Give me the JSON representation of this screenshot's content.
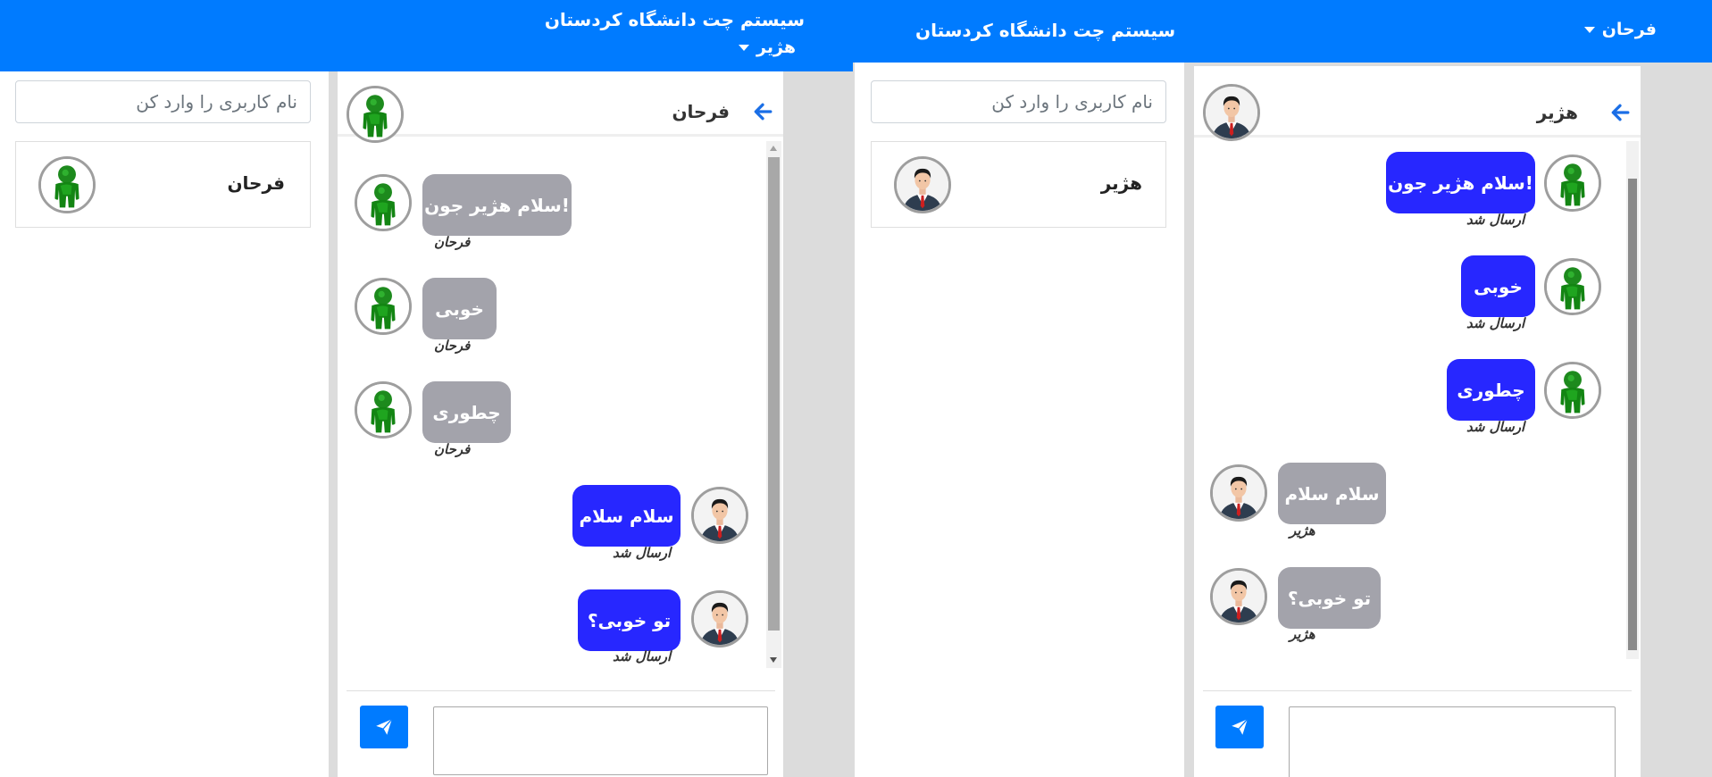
{
  "left_window": {
    "navbar": {
      "brand": "سیستم چت دانشگاه کردستان",
      "current_user": "هژیر"
    },
    "sidebar": {
      "search_placeholder": "نام کاربری را وارد کن",
      "contacts": [
        {
          "name": "فرحان",
          "avatar": "green-user-avatar"
        }
      ]
    },
    "chat": {
      "title": "فرحان",
      "messages": [
        {
          "direction": "incoming",
          "text": "!سلام هژیر جون",
          "meta": "فرحان",
          "avatar": "green-user-avatar"
        },
        {
          "direction": "incoming",
          "text": "خوبی",
          "meta": "فرحان",
          "avatar": "green-user-avatar"
        },
        {
          "direction": "incoming",
          "text": "چطوری",
          "meta": "فرحان",
          "avatar": "green-user-avatar"
        },
        {
          "direction": "outgoing",
          "text": "سلام سلام",
          "meta": "ارسال شد",
          "avatar": "businessman-avatar"
        },
        {
          "direction": "outgoing",
          "text": "تو خوبی؟",
          "meta": "ارسال شد",
          "avatar": "businessman-avatar"
        }
      ]
    }
  },
  "right_window": {
    "navbar": {
      "brand": "سیستم چت دانشگاه کردستان",
      "current_user": "فرحان"
    },
    "sidebar": {
      "search_placeholder": "نام کاربری را وارد کن",
      "contacts": [
        {
          "name": "هژیر",
          "avatar": "businessman-avatar"
        }
      ]
    },
    "chat": {
      "title": "هژیر",
      "messages": [
        {
          "direction": "outgoing",
          "text": "!سلام هژیر جون",
          "meta": "ارسال شد",
          "avatar": "green-user-avatar"
        },
        {
          "direction": "outgoing",
          "text": "خوبی",
          "meta": "ارسال شد",
          "avatar": "green-user-avatar"
        },
        {
          "direction": "outgoing",
          "text": "چطوری",
          "meta": "ارسال شد",
          "avatar": "green-user-avatar"
        },
        {
          "direction": "incoming",
          "text": "سلام سلام",
          "meta": "هژیر",
          "avatar": "businessman-avatar"
        },
        {
          "direction": "incoming",
          "text": "تو خوبی؟",
          "meta": "هژیر",
          "avatar": "businessman-avatar"
        }
      ]
    }
  },
  "icons": {
    "back": "arrow-left-icon",
    "send": "paper-plane-icon",
    "dropdown": "caret-down-icon"
  },
  "colors": {
    "navbar": "#007bff",
    "outgoing_bubble": "#2727ff",
    "incoming_bubble": "#a3a3ab",
    "send_button": "#007bff"
  }
}
